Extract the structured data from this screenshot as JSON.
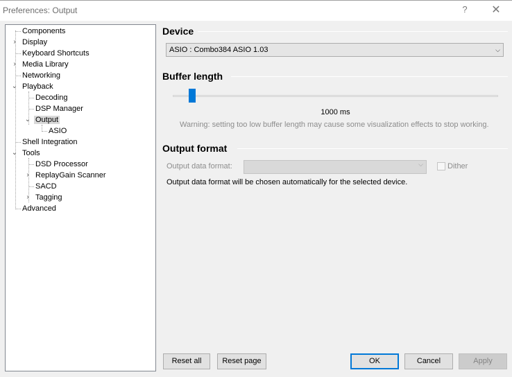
{
  "window": {
    "title": "Preferences: Output",
    "help": "?",
    "close": "✕"
  },
  "tree": {
    "components": "Components",
    "display": "Display",
    "keyboard_shortcuts": "Keyboard Shortcuts",
    "media_library": "Media Library",
    "networking": "Networking",
    "playback": "Playback",
    "decoding": "Decoding",
    "dsp_manager": "DSP Manager",
    "output": "Output",
    "asio": "ASIO",
    "shell_integration": "Shell Integration",
    "tools": "Tools",
    "dsd_processor": "DSD Processor",
    "replaygain_scanner": "ReplayGain Scanner",
    "sacd": "SACD",
    "tagging": "Tagging",
    "advanced": "Advanced"
  },
  "device": {
    "heading": "Device",
    "selected": "ASIO : Combo384 ASIO 1.03"
  },
  "buffer": {
    "heading": "Buffer length",
    "value_label": "1000 ms",
    "slider_fraction": 0.04,
    "warning": "Warning: setting too low buffer length may cause some visualization effects to stop working."
  },
  "output_format": {
    "heading": "Output format",
    "label": "Output data format:",
    "selected": "",
    "dither_label": "Dither",
    "dither_checked": false,
    "note": "Output data format will be chosen automatically for the selected device."
  },
  "buttons": {
    "reset_all": "Reset all",
    "reset_page": "Reset page",
    "ok": "OK",
    "cancel": "Cancel",
    "apply": "Apply"
  },
  "colors": {
    "accent": "#0078d7",
    "selection": "#d9d9d9"
  }
}
